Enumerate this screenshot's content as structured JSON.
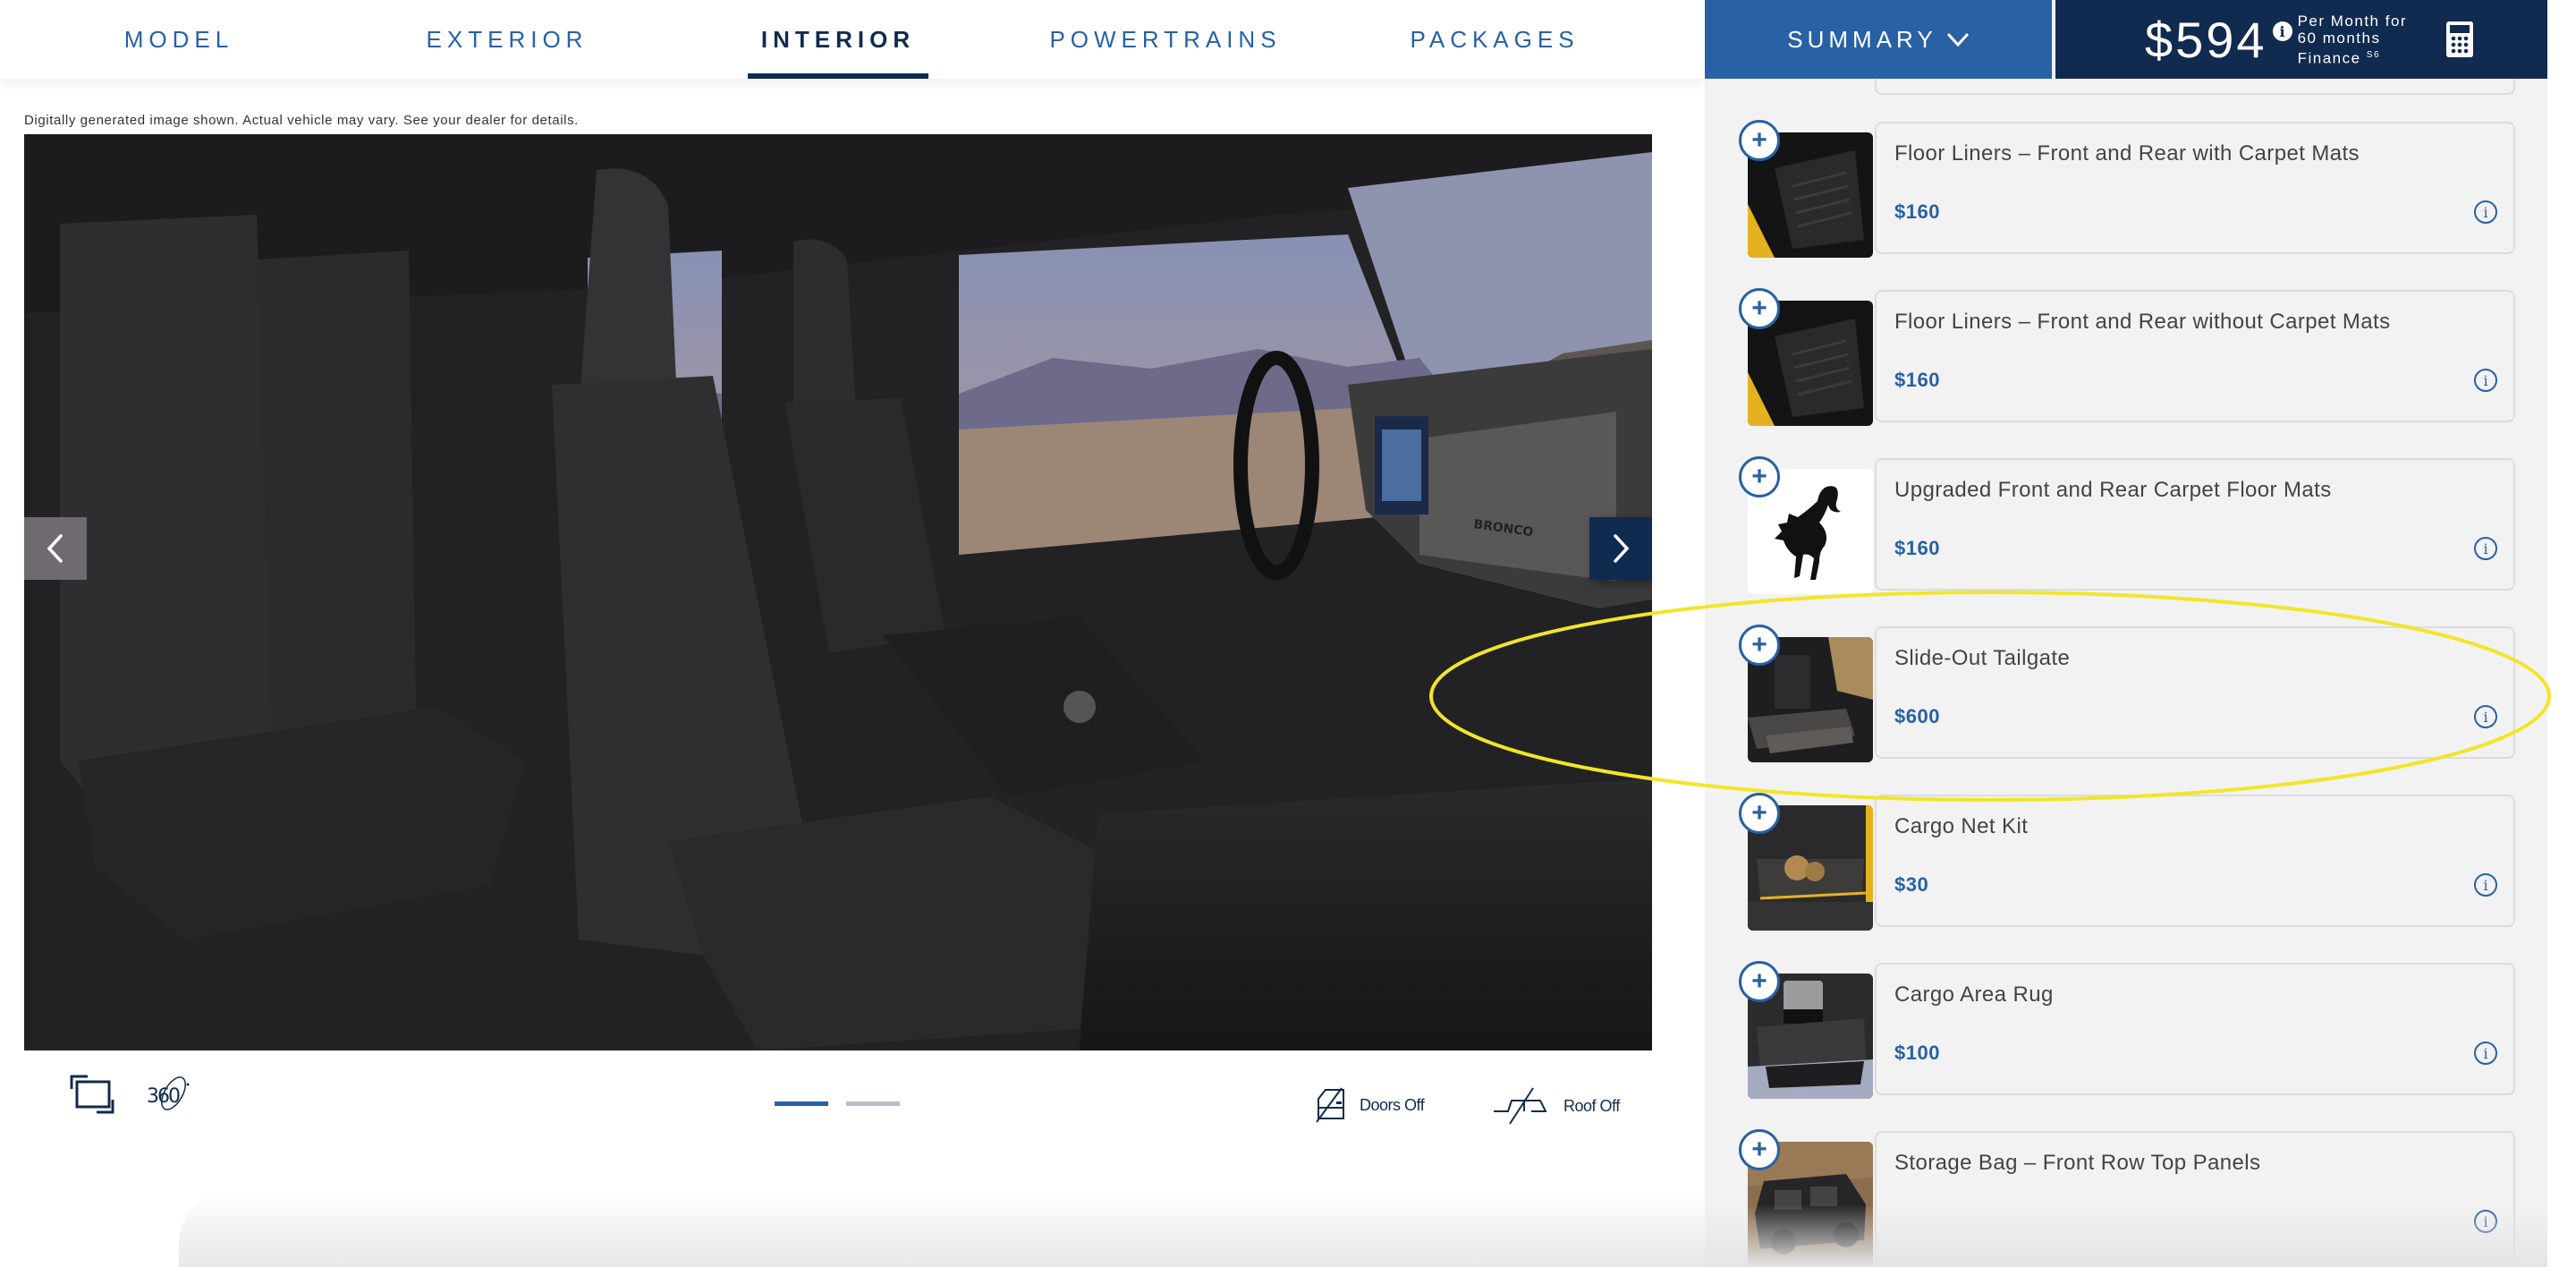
{
  "nav": {
    "tabs": [
      {
        "label": "MODEL",
        "active": false
      },
      {
        "label": "EXTERIOR",
        "active": false
      },
      {
        "label": "INTERIOR",
        "active": true
      },
      {
        "label": "POWERTRAINS",
        "active": false
      },
      {
        "label": "PACKAGES",
        "active": false
      }
    ],
    "summary_label": "SUMMARY",
    "price": {
      "amount": "$594",
      "term_line1": "Per Month for",
      "term_line2": "60 months",
      "term_line3": "Finance",
      "footnote": "S6"
    }
  },
  "viewer": {
    "disclaimer": "Digitally generated image shown. Actual vehicle may vary. See your dealer for details.",
    "image_alt": "Ford Bronco interior view with black seats and desert mountain view",
    "dash_badge": "BRONCO",
    "icons": {
      "prev": "chevron-left-icon",
      "next": "chevron-right-icon",
      "fullscreen": "fullscreen-icon",
      "view360": "360-view-icon"
    },
    "view360_label": "360",
    "carousel": {
      "current": 1,
      "total": 2
    },
    "toggles": {
      "doors_off": "Doors Off",
      "roof_off": "Roof Off"
    }
  },
  "accessories": {
    "items": [
      {
        "name": "Floor Liners – Front and Rear with Carpet Mats",
        "price": "$160",
        "thumb": "floor-liner"
      },
      {
        "name": "Floor Liners – Front and Rear without Carpet Mats",
        "price": "$160",
        "thumb": "floor-liner"
      },
      {
        "name": "Upgraded Front and Rear Carpet Floor Mats",
        "price": "$160",
        "thumb": "bronco-horse-logo"
      },
      {
        "name": "Slide-Out Tailgate",
        "price": "$600",
        "thumb": "slide-out-tailgate"
      },
      {
        "name": "Cargo Net Kit",
        "price": "$30",
        "thumb": "cargo-net"
      },
      {
        "name": "Cargo Area Rug",
        "price": "$100",
        "thumb": "cargo-rug"
      },
      {
        "name": "Storage Bag – Front Row Top Panels",
        "price": "",
        "thumb": "bronco-vehicle"
      }
    ],
    "add_symbol": "+",
    "info_symbol": "i"
  },
  "annotation": {
    "type": "highlight-ellipse",
    "color": "#f2e529",
    "target": "Slide-Out Tailgate"
  },
  "colors": {
    "brand_blue": "#2861a4",
    "navy": "#112a4f",
    "panel_bg": "#f2f2f2"
  }
}
